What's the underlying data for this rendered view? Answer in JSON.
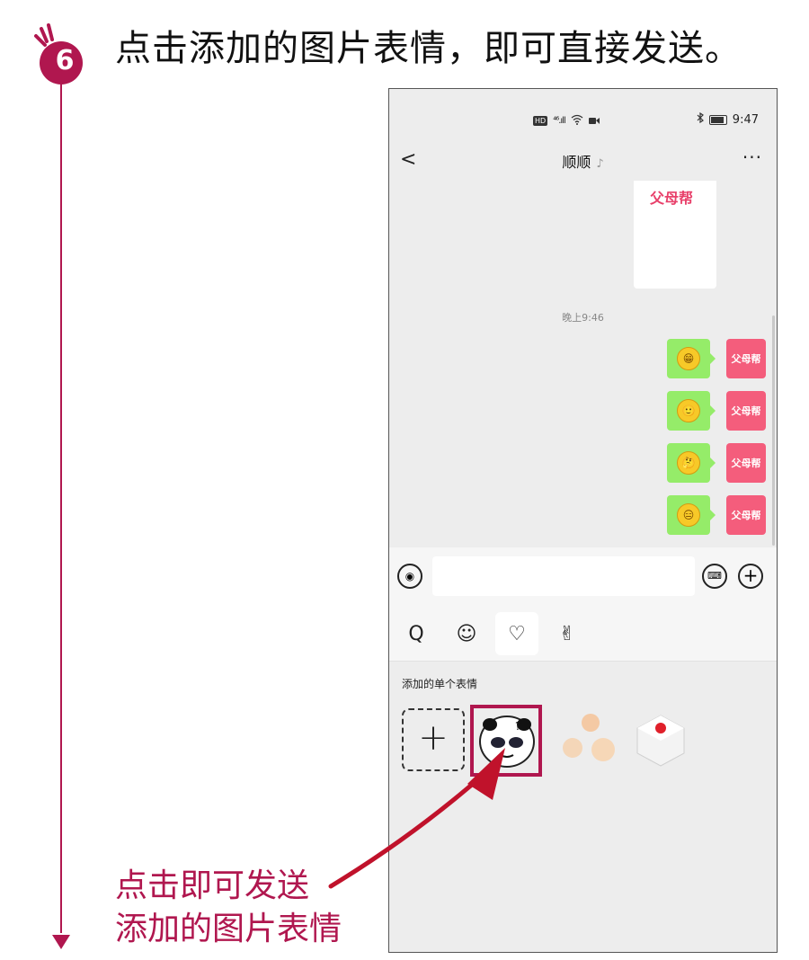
{
  "step": {
    "number": "6",
    "title": "点击添加的图片表情，即可直接发送。",
    "accent_color": "#b0174f"
  },
  "caption": {
    "line1": "点击即可发送",
    "line2": "添加的图片表情"
  },
  "phone": {
    "status_bar": {
      "left_icons": [
        "HD",
        "4G",
        "signal-icon",
        "wifi-icon",
        "video-icon"
      ],
      "hd_label": "HD",
      "signal_label": "⁴⁶.ıll",
      "time": "9:47"
    },
    "navbar": {
      "back_label": "<",
      "title": "顺顺",
      "more_label": "···"
    },
    "chat": {
      "previous_card_text": "父母帮",
      "timestamp": "晚上9:46",
      "messages": [
        {
          "emoji": "😁",
          "avatar_text": "父母帮"
        },
        {
          "emoji": "🙂",
          "avatar_text": "父母帮"
        },
        {
          "emoji": "🤔",
          "avatar_text": "父母帮"
        },
        {
          "emoji": "😑",
          "avatar_text": "父母帮"
        }
      ]
    },
    "input_bar": {
      "voice_icon": "voice-icon",
      "emoji_icon": "keyboard-icon",
      "plus_icon": "plus-circle-icon",
      "plus_label": "+",
      "voice_label": "◉"
    },
    "sticker_tabs": [
      {
        "icon": "search-icon",
        "glyph": "Q"
      },
      {
        "icon": "smiley-icon",
        "glyph": "☺"
      },
      {
        "icon": "heart-icon",
        "glyph": "♡"
      },
      {
        "icon": "hand-icon",
        "glyph": "✌"
      }
    ],
    "panel": {
      "title": "添加的单个表情",
      "add_label": "+"
    }
  }
}
